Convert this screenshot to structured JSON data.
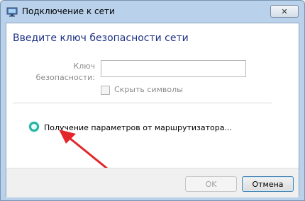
{
  "window": {
    "title": "Подключение к сети",
    "close_symbol": "✕"
  },
  "dialog": {
    "heading": "Введите ключ безопасности сети",
    "key_label_line1": "Ключ",
    "key_label_line2": "безопасности:",
    "key_value": "",
    "show_chars_label": "Скрыть символы",
    "show_chars_checked": false,
    "status_text": "Получение параметров от маршрутизатора..."
  },
  "buttons": {
    "ok": "OK",
    "cancel": "Отмена"
  },
  "colors": {
    "heading": "#1e3287",
    "arrow": "#e3262a",
    "spinner": "#25b3a3"
  }
}
